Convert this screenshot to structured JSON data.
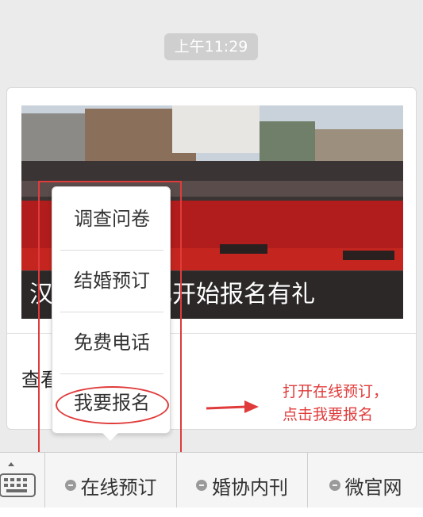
{
  "chat": {
    "timestamp": "上午11:29"
  },
  "article": {
    "caption": "汉服集体婚礼开始报名有礼",
    "link_text": "查看全文"
  },
  "popup_menu": {
    "items": [
      "调查问卷",
      "结婚预订",
      "免费电话",
      "我要报名"
    ]
  },
  "annotation": {
    "line1": "打开在线预订，",
    "line2": "点击我要报名",
    "color": "#e03b3b"
  },
  "menu_bar": {
    "keyboard_icon": "keyboard-icon",
    "tabs": [
      "在线预订",
      "婚协内刊",
      "微官网"
    ]
  }
}
